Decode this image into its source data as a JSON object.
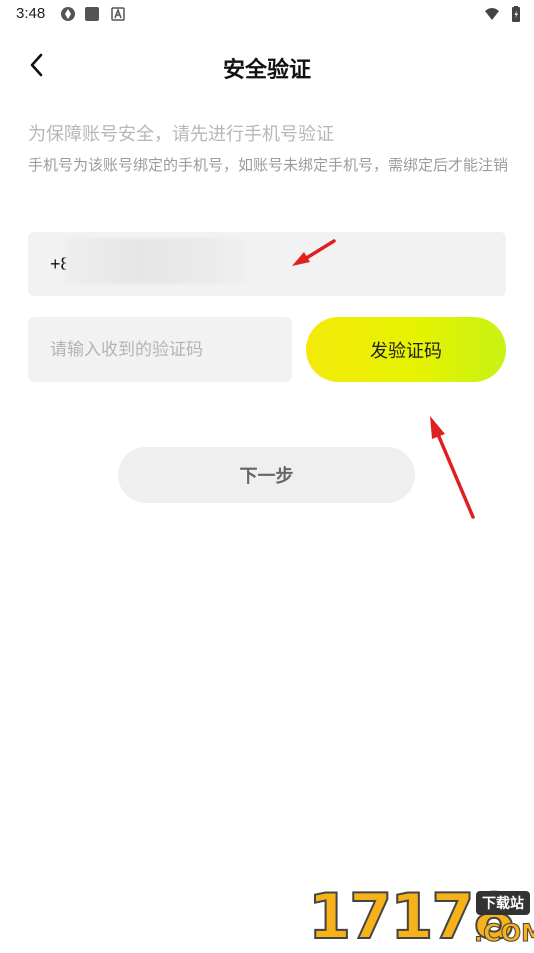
{
  "status_bar": {
    "time": "3:48",
    "icons": [
      "sync-icon",
      "square-icon",
      "a-icon",
      "wifi-icon",
      "battery-icon"
    ]
  },
  "header": {
    "title": "安全验证",
    "back_icon": "chevron-left-icon"
  },
  "info": {
    "main": "为保障账号安全，请先进行手机号验证",
    "sub": "手机号为该账号绑定的手机号，如账号未绑定手机号，需绑定后才能注销"
  },
  "phone": {
    "prefix": "+8"
  },
  "code": {
    "placeholder": "请输入收到的验证码",
    "value": "",
    "send_label": "发验证码"
  },
  "next": {
    "label": "下一步"
  },
  "colors": {
    "accent_start": "#f4ea0a",
    "accent_end": "#c7f214",
    "field_bg": "#f2f2f2",
    "annotation": "#e02020"
  },
  "watermark": {
    "digits": "17178",
    "tag": "下载站",
    "suffix": ".COM"
  }
}
